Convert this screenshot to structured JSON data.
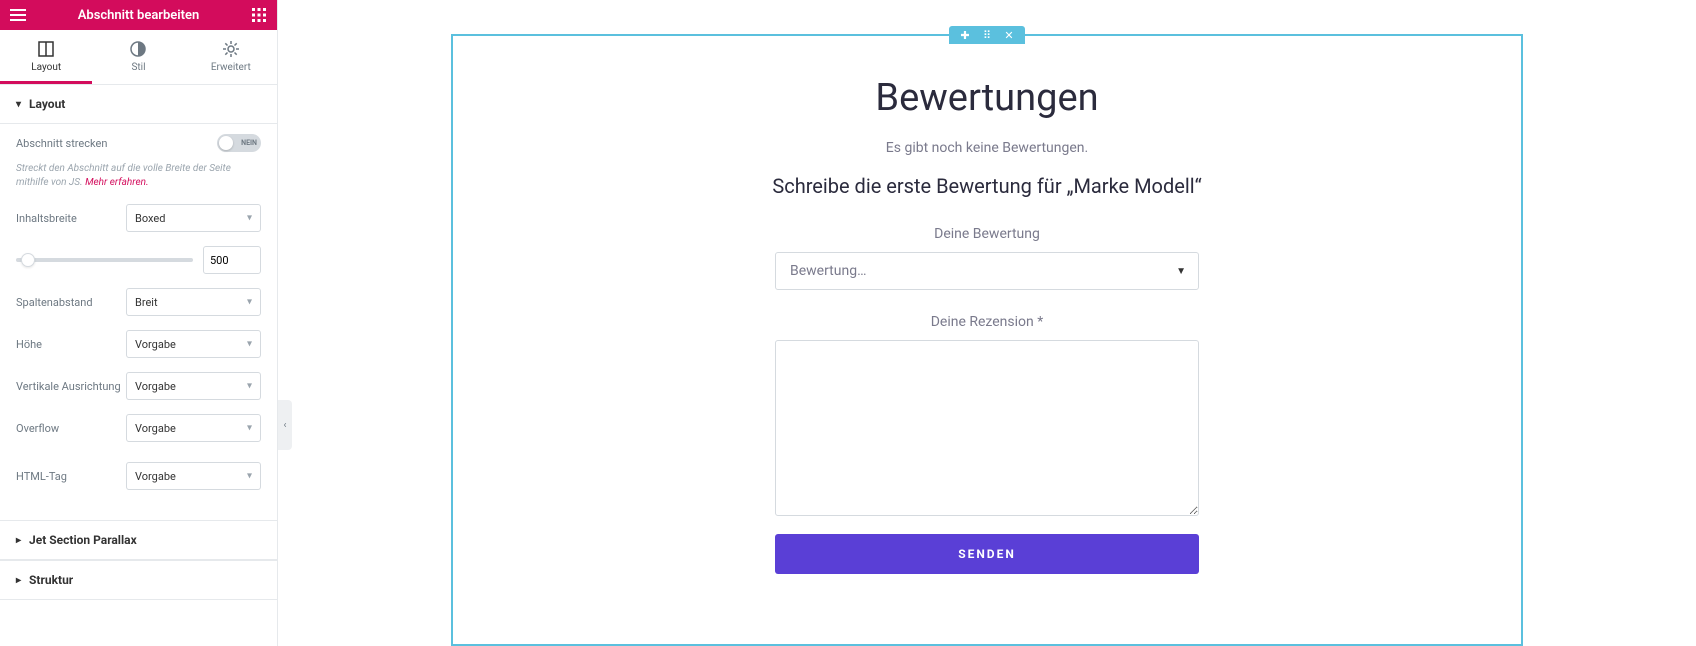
{
  "sidebar": {
    "title": "Abschnitt bearbeiten",
    "tabs": {
      "layout": "Layout",
      "style": "Stil",
      "advanced": "Erweitert"
    },
    "sections": {
      "layout_header": "Layout",
      "parallax_header": "Jet Section Parallax",
      "structure_header": "Struktur"
    },
    "controls": {
      "stretch_label": "Abschnitt strecken",
      "stretch_toggle_text": "NEIN",
      "stretch_helper_prefix": "Streckt den Abschnitt auf die volle Breite der Seite mithilfe von JS. ",
      "stretch_helper_link": "Mehr erfahren.",
      "content_width_label": "Inhaltsbreite",
      "content_width_value": "Boxed",
      "width_value": "500",
      "column_gap_label": "Spaltenabstand",
      "column_gap_value": "Breit",
      "height_label": "Höhe",
      "height_value": "Vorgabe",
      "vertical_align_label": "Vertikale Ausrichtung",
      "vertical_align_value": "Vorgabe",
      "overflow_label": "Overflow",
      "overflow_value": "Vorgabe",
      "html_tag_label": "HTML-Tag",
      "html_tag_value": "Vorgabe"
    }
  },
  "preview": {
    "heading": "Bewertungen",
    "no_reviews": "Es gibt noch keine Bewertungen.",
    "write_first": "Schreibe die erste Bewertung für „Marke Modell“",
    "rating_label": "Deine Bewertung",
    "rating_placeholder": "Bewertung…",
    "review_label": "Deine Rezension *",
    "submit_label": "SENDEN"
  }
}
